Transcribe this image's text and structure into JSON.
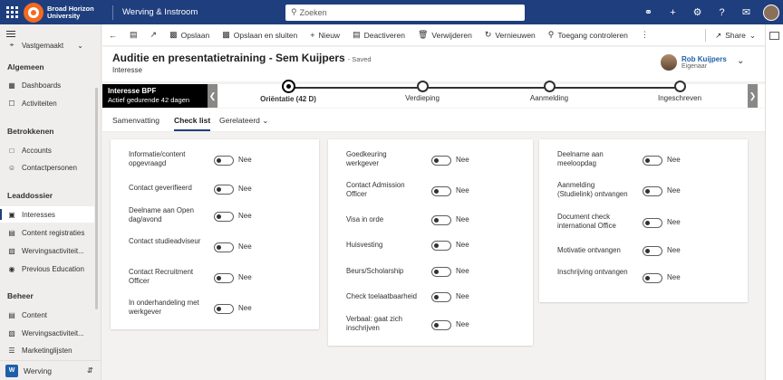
{
  "topbar": {
    "logo_line1": "Broad Horizon",
    "logo_line2": "University",
    "app_name": "Werving & Instroom",
    "search_placeholder": "Zoeken"
  },
  "nav": {
    "partial_item": "Vastgemaakt",
    "groups": [
      {
        "title": "Algemeen",
        "items": [
          {
            "label": "Dashboards",
            "icon": "dashboard-icon"
          },
          {
            "label": "Activiteiten",
            "icon": "activity-icon"
          }
        ]
      },
      {
        "title": "Betrokkenen",
        "items": [
          {
            "label": "Accounts",
            "icon": "accounts-icon"
          },
          {
            "label": "Contactpersonen",
            "icon": "contact-icon"
          }
        ]
      },
      {
        "title": "Leaddossier",
        "items": [
          {
            "label": "Interesses",
            "icon": "interest-icon",
            "active": true
          },
          {
            "label": "Content registraties",
            "icon": "content-reg-icon"
          },
          {
            "label": "Wervingsactiviteit...",
            "icon": "recruit-activity-icon"
          },
          {
            "label": "Previous Education",
            "icon": "education-icon"
          }
        ]
      },
      {
        "title": "Beheer",
        "items": [
          {
            "label": "Content",
            "icon": "content-icon"
          },
          {
            "label": "Wervingsactiviteit...",
            "icon": "recruit-activity-icon"
          },
          {
            "label": "Marketinglijsten",
            "icon": "marketing-list-icon"
          }
        ]
      }
    ],
    "area_badge": "W",
    "area_label": "Werving"
  },
  "commands": {
    "save": "Opslaan",
    "save_close": "Opslaan en sluiten",
    "new": "Nieuw",
    "deactivate": "Deactiveren",
    "delete": "Verwijderen",
    "refresh": "Vernieuwen",
    "check_access": "Toegang controleren",
    "share": "Share"
  },
  "record": {
    "title": "Auditie en presentatietraining - Sem Kuijpers",
    "saved": "- Saved",
    "entity": "Interesse",
    "owner_name": "Rob Kuijpers",
    "owner_role": "Eigenaar"
  },
  "bpf": {
    "title": "Interesse BPF",
    "subtitle": "Actief gedurende 42 dagen",
    "stages": [
      {
        "label": "Oriëntatie  (42 D)",
        "current": true
      },
      {
        "label": "Verdieping",
        "current": false
      },
      {
        "label": "Aanmelding",
        "current": false
      },
      {
        "label": "Ingeschreven",
        "current": false
      }
    ]
  },
  "tabs": {
    "summary": "Samenvatting",
    "checklist": "Check list",
    "related": "Gerelateerd"
  },
  "checklist": {
    "col1": [
      {
        "label": "Informatie/content opgevraagd",
        "value": "Nee"
      },
      {
        "label": "Contact geverifieerd",
        "value": "Nee"
      },
      {
        "label": "Deelname aan Open dag/avond",
        "value": "Nee"
      },
      {
        "label": "Contact studieadviseur",
        "value": "Nee"
      },
      {
        "label": "Contact Recruitment Officer",
        "value": "Nee"
      },
      {
        "label": "In onderhandeling met werkgever",
        "value": "Nee"
      }
    ],
    "col2": [
      {
        "label": "Goedkeuring werkgever",
        "value": "Nee"
      },
      {
        "label": "Contact Admission Officer",
        "value": "Nee"
      },
      {
        "label": "Visa in orde",
        "value": "Nee"
      },
      {
        "label": "Huisvesting",
        "value": "Nee"
      },
      {
        "label": "Beurs/Scholarship",
        "value": "Nee"
      },
      {
        "label": "Check toelaatbaarheid",
        "value": "Nee"
      },
      {
        "label": "Verbaal: gaat zich inschrijven",
        "value": "Nee"
      }
    ],
    "col3": [
      {
        "label": "Deelname aan meeloopdag",
        "value": "Nee"
      },
      {
        "label": "Aanmelding (Studielink) ontvangen",
        "value": "Nee"
      },
      {
        "label": "Document check international Office",
        "value": "Nee"
      },
      {
        "label": "Motivatie ontvangen",
        "value": "Nee"
      },
      {
        "label": "Inschrijving ontvangen",
        "value": "Nee"
      }
    ]
  }
}
